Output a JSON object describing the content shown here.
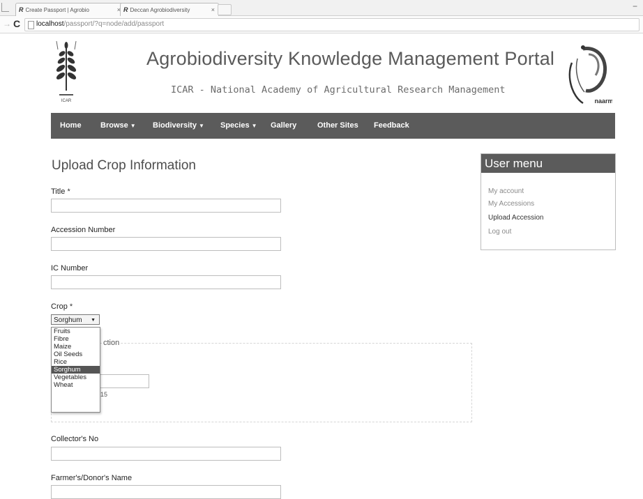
{
  "browser": {
    "tabs": [
      {
        "label": "Create Passport | Agrobio",
        "close": "×"
      },
      {
        "label": "Deccan Agrobiodiversity",
        "close": "×"
      }
    ],
    "window_control": "−",
    "back_icon": "arrow-left-icon",
    "reload_icon": "reload-icon",
    "url_host": "localhost",
    "url_path": "/passport/?q=node/add/passport"
  },
  "header": {
    "title": "Agrobiodiversity Knowledge Management Portal",
    "subtitle": "ICAR - National Academy of Agricultural Research Management",
    "left_logo_caption": "ICAR",
    "right_logo_caption": "naarm"
  },
  "nav": {
    "items": [
      {
        "label": "Home",
        "caret": ""
      },
      {
        "label": "Browse",
        "caret": "▼"
      },
      {
        "label": "Biodiversity",
        "caret": "▼"
      },
      {
        "label": "Species",
        "caret": "▼"
      },
      {
        "label": "Gallery",
        "caret": ""
      },
      {
        "label": "Other Sites",
        "caret": ""
      },
      {
        "label": "Feedback",
        "caret": ""
      }
    ]
  },
  "form": {
    "page_title": "Upload Crop Information",
    "title_label": "Title",
    "required_mark": "*",
    "accession_label": "Accession Number",
    "ic_label": "IC Number",
    "crop_label": "Crop",
    "crop_selected": "Sorghum",
    "crop_options": [
      "Fruits",
      "Fibre",
      "Maize",
      "Oil Seeds",
      "Rice",
      "Sorghum",
      "Vegetables",
      "Wheat"
    ],
    "legend_fragment": "ction",
    "sub_fragment": "15",
    "collector_label": "Collector's No",
    "farmer_label": "Farmer's/Donor's Name"
  },
  "sidebar": {
    "title": "User menu",
    "links": [
      "My account",
      "My Accessions",
      "Upload Accession",
      "Log out"
    ]
  }
}
